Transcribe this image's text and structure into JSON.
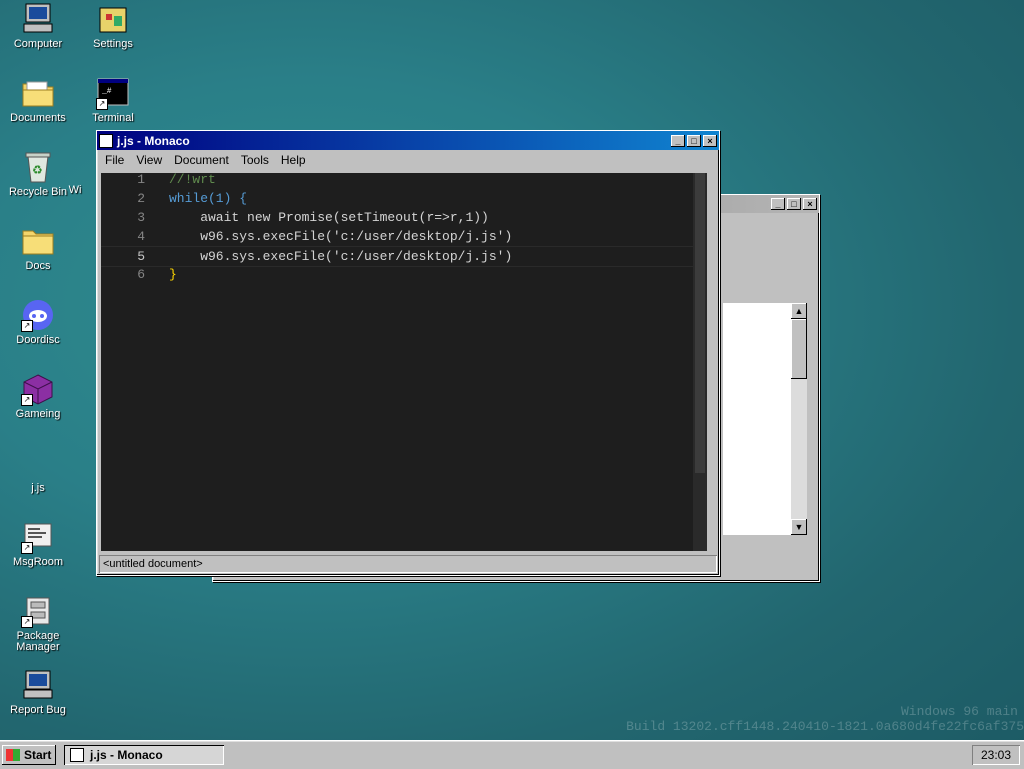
{
  "desktop": {
    "icons": [
      {
        "label": "Computer"
      },
      {
        "label": "Settings"
      },
      {
        "label": "Documents"
      },
      {
        "label": "Terminal"
      },
      {
        "label": "Recycle Bin"
      },
      {
        "label": "Docs"
      },
      {
        "label": "Doordisc"
      },
      {
        "label": "Gameing"
      },
      {
        "label": "j.js"
      },
      {
        "label": "MsgRoom"
      },
      {
        "label": "Package Manager"
      },
      {
        "label": "Report Bug"
      }
    ],
    "partial_label": "Wi",
    "watermark_line1": "Windows 96 main",
    "watermark_line2": "Build 13202.cff1448.240410-1821.0a680d4fe22fc6af375"
  },
  "editor_window": {
    "title": "j.js - Monaco",
    "menu": [
      "File",
      "View",
      "Document",
      "Tools",
      "Help"
    ],
    "status": "<untitled document>",
    "lines": [
      {
        "num": "1",
        "text": "//!wrt"
      },
      {
        "num": "2",
        "text": "while(1) {"
      },
      {
        "num": "3",
        "text": "    await new Promise(setTimeout(r=>r,1))"
      },
      {
        "num": "4",
        "text": "    w96.sys.execFile('c:/user/desktop/j.js')"
      },
      {
        "num": "5",
        "text": "    w96.sys.execFile('c:/user/desktop/j.js')"
      },
      {
        "num": "6",
        "text": "}"
      }
    ]
  },
  "taskbar": {
    "start_label": "Start",
    "active_task": "j.js - Monaco",
    "clock": "23:03"
  },
  "colors": {
    "titlebar_active": "#000080",
    "editor_bg": "#1e1e1e"
  }
}
